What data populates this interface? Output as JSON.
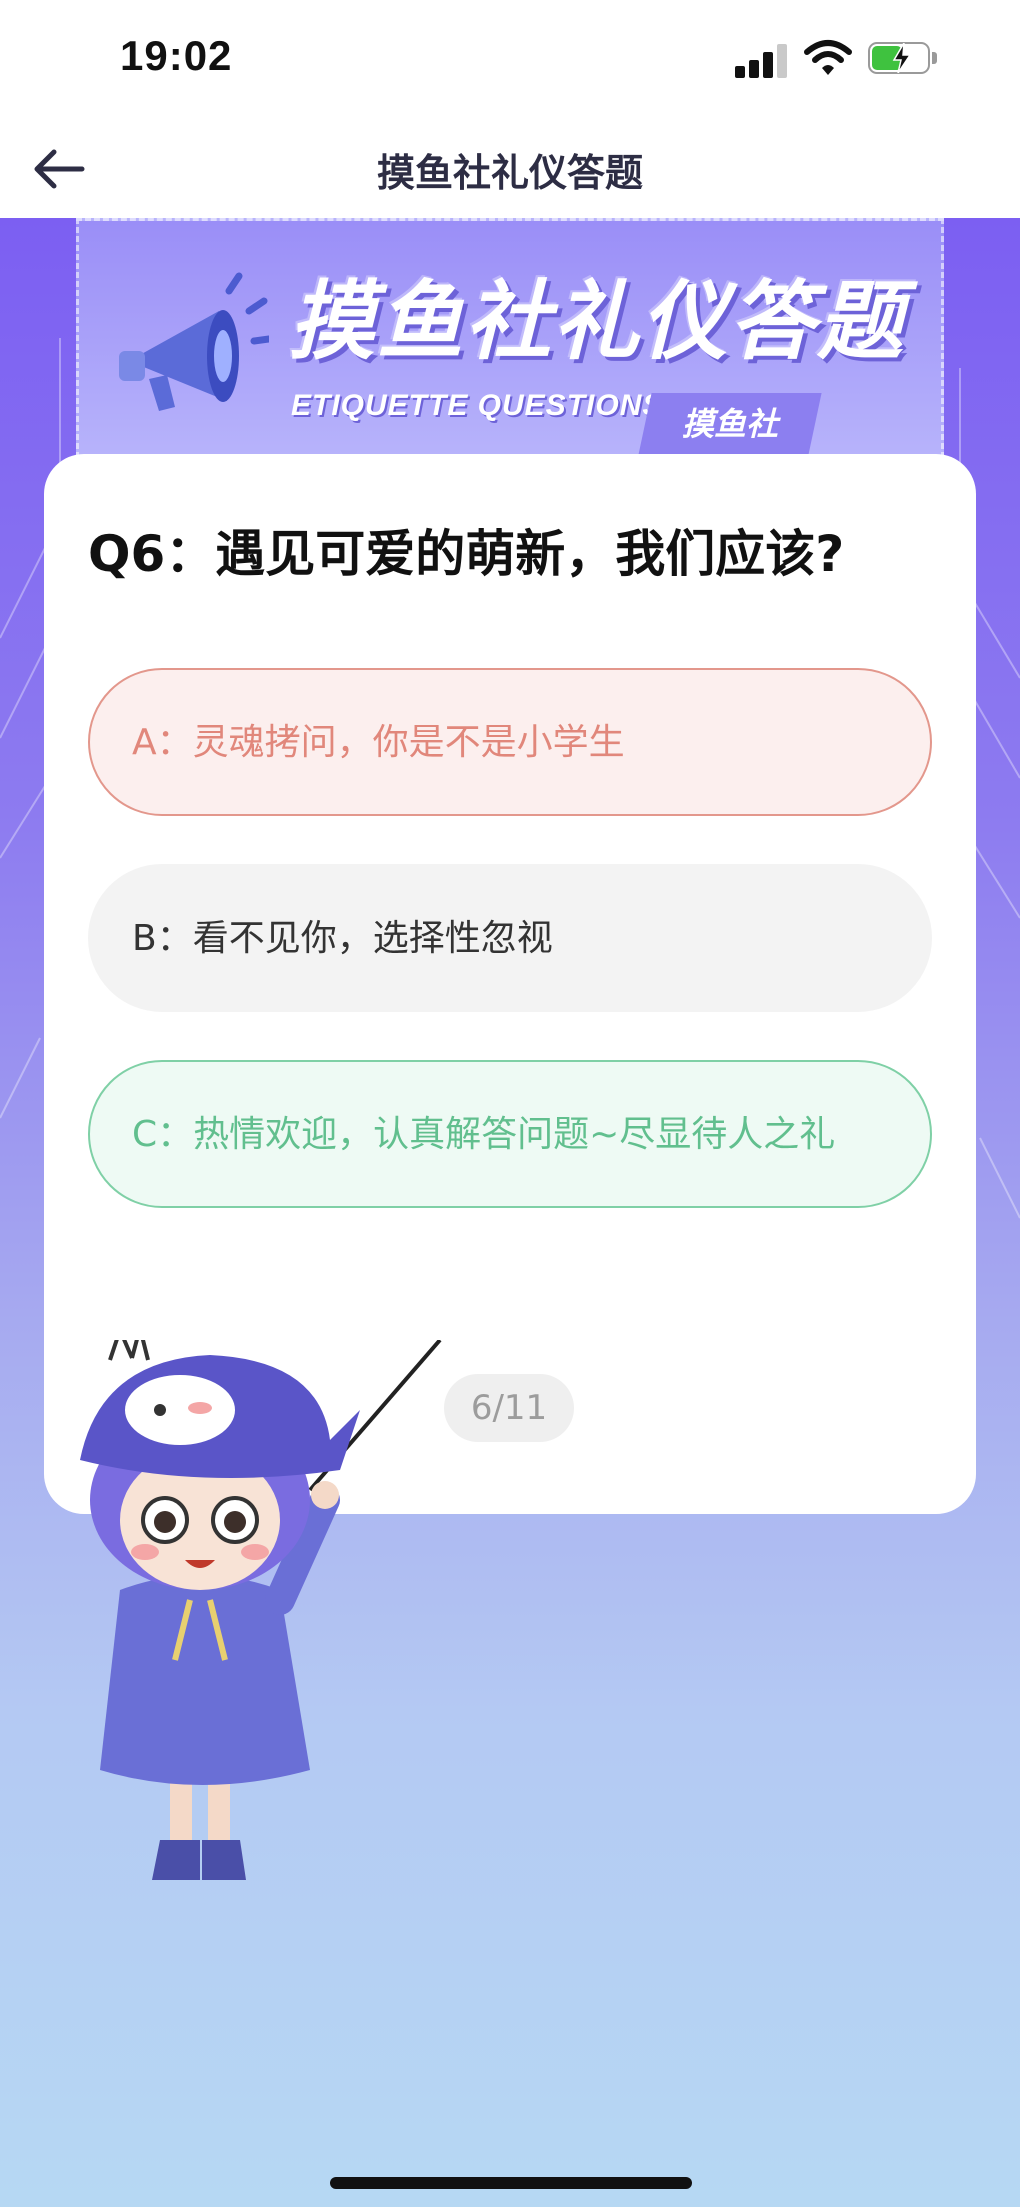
{
  "status_bar": {
    "time": "19:02"
  },
  "nav": {
    "title": "摸鱼社礼仪答题"
  },
  "banner": {
    "title": "摸鱼社礼仪答题",
    "subtitle": "ETIQUETTE QUESTIONS",
    "tag": "摸鱼社"
  },
  "quiz": {
    "question": "Q6：遇见可爱的萌新，我们应该?",
    "options": [
      {
        "label": "A：灵魂拷问，你是不是小学生",
        "state": "wrong"
      },
      {
        "label": "B：看不见你，选择性忽视",
        "state": "neutral"
      },
      {
        "label": "C：热情欢迎，认真解答问题~尽显待人之礼",
        "state": "correct"
      }
    ],
    "progress": "6/11"
  },
  "colors": {
    "wrong": "#e1877b",
    "correct": "#61bf8e",
    "background_top": "#7c5ff2",
    "background_bottom": "#b6d8f3"
  }
}
